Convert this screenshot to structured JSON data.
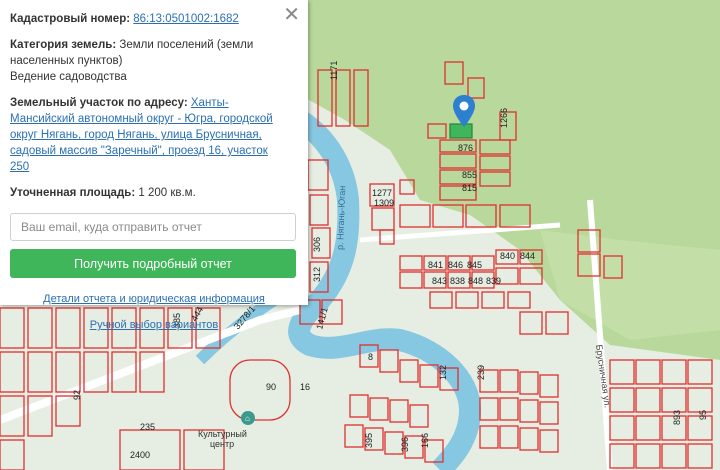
{
  "panel": {
    "cadastral_label": "Кадастровый номер:",
    "cadastral_value": "86:13:0501002:1682",
    "category_label": "Категория земель:",
    "category_value": "Земли поселений (земли населенных пунктов)",
    "usage_value": "Ведение садоводства",
    "address_label": "Земельный участок по адресу:",
    "address_value": "Ханты-Мансийский автономный округ - Югра, городской округ Нягань, город Нягань, улица Брусничная, садовый массив \"Заречный\", проезд 16, участок 250",
    "area_label": "Уточненная площадь:",
    "area_value": "1 200 кв.м.",
    "email_placeholder": "Ваш email, куда отправить отчет",
    "report_button": "Получить подробный отчет",
    "details_link": "Детали отчета и юридическая информация",
    "manual_link": "Ручной выбор вариантов",
    "close_symbol": "✕"
  },
  "map": {
    "river_label": "р. Нягань-Юган",
    "street_label": "Брусничная ул.",
    "culture_center_line1": "Культурный",
    "culture_center_line2": "центр",
    "parcel_numbers": [
      "1171",
      "1266",
      "876",
      "855",
      "815",
      "1277",
      "1309",
      "841",
      "846",
      "845",
      "840",
      "844",
      "843",
      "838",
      "848",
      "839",
      "306",
      "312",
      "141/1",
      "3278/1",
      "385",
      "444",
      "90",
      "8",
      "132",
      "239",
      "166",
      "395",
      "396",
      "235",
      "2400",
      "92",
      "16",
      "893",
      "95"
    ],
    "colors": {
      "parcel": "#e03030",
      "river": "#7fc4e0",
      "forest": "#b8d99b",
      "land": "#ecefe9",
      "road": "#ffffff"
    }
  }
}
